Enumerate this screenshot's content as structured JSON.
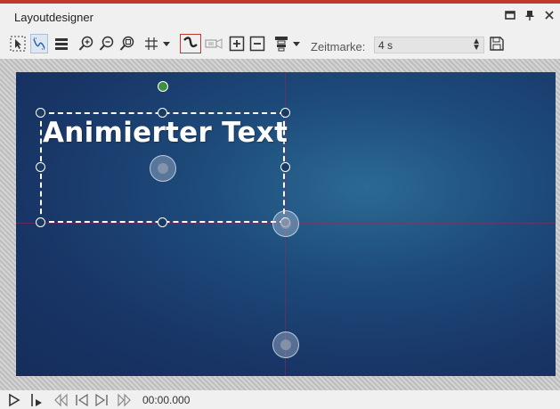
{
  "window": {
    "title": "Layoutdesigner",
    "controls": [
      "maximize-icon",
      "pin-icon",
      "close-icon"
    ]
  },
  "toolbar": {
    "tools": [
      "selection-tool-icon",
      "curve-tool-icon",
      "layers-icon",
      "zoom-in-icon",
      "zoom-out-icon",
      "zoom-fit-icon",
      "grid-icon",
      "path-tool-icon",
      "camera-icon",
      "add-keyframe-icon",
      "remove-keyframe-icon",
      "align-icon"
    ],
    "zeitmarke_label": "Zeitmarke:",
    "zeitmarke_value": "4 s"
  },
  "canvas": {
    "text": "Animierter Text",
    "accent": "#c0392b",
    "background": "#1d4a7a"
  },
  "playback": {
    "controls": [
      "play-icon",
      "play-from-mark-icon",
      "rewind-icon",
      "previous-frame-icon",
      "next-frame-icon",
      "fast-forward-icon"
    ],
    "timecode": "00:00.000"
  }
}
